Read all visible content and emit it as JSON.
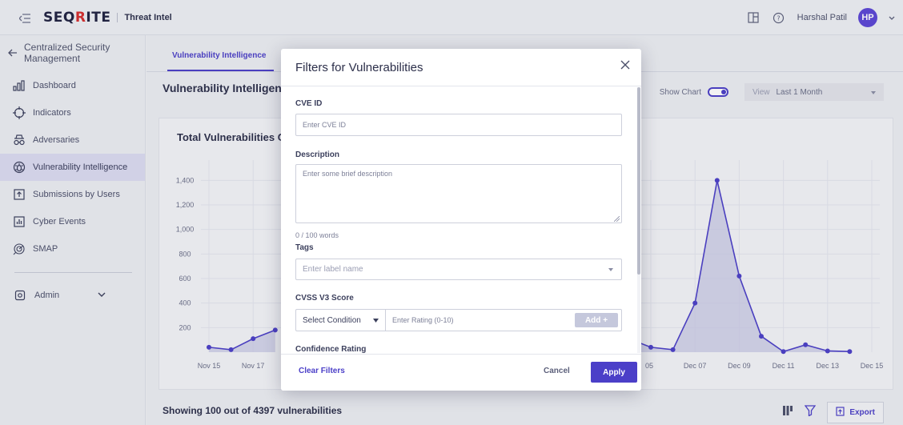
{
  "header": {
    "logo_text_a": "SEQ",
    "logo_text_b": "R",
    "logo_text_c": "ITE",
    "product_name": "Threat Intel",
    "user_name": "Harshal Patil",
    "user_initials": "HP"
  },
  "sidebar": {
    "back_label": "Centralized Security Management",
    "items": [
      {
        "label": "Dashboard",
        "icon": "bar-chart-icon"
      },
      {
        "label": "Indicators",
        "icon": "crosshair-icon"
      },
      {
        "label": "Adversaries",
        "icon": "spy-icon"
      },
      {
        "label": "Vulnerability Intelligence",
        "icon": "bug-icon",
        "active": true
      },
      {
        "label": "Submissions by Users",
        "icon": "upload-icon"
      },
      {
        "label": "Cyber Events",
        "icon": "report-icon"
      },
      {
        "label": "SMAP",
        "icon": "radar-icon"
      }
    ],
    "admin_label": "Admin"
  },
  "main": {
    "tab_label": "Vulnerability Intelligence",
    "page_title": "Vulnerability Intelligence",
    "show_chart_label": "Show Chart",
    "view_label": "View",
    "view_value": "Last 1 Month",
    "chart_title": "Total Vulnerabilities C",
    "showing_text": "Showing 100 out of 4397 vulnerabilities",
    "export_label": "Export"
  },
  "chart_data": {
    "type": "area",
    "title": "Total Vulnerabilities C",
    "y_ticks": [
      "1,400",
      "1,200",
      "1,000",
      "800",
      "600",
      "400",
      "200"
    ],
    "ylim": [
      0,
      1500
    ],
    "x_tick_labels_left": [
      "Nov 15",
      "Nov 17"
    ],
    "x_tick_labels_right": [
      "05",
      "Dec 07",
      "Dec 09",
      "Dec 11",
      "Dec 13",
      "Dec 15"
    ],
    "series_left": [
      {
        "date": "Nov 15",
        "value": 40
      },
      {
        "date": "Nov 16",
        "value": 20
      },
      {
        "date": "Nov 17",
        "value": 110
      },
      {
        "date": "Nov 18",
        "value": 180
      }
    ],
    "series_right": [
      {
        "date": "Dec 04",
        "value": 110
      },
      {
        "date": "Dec 05",
        "value": 40
      },
      {
        "date": "Dec 06",
        "value": 20
      },
      {
        "date": "Dec 07",
        "value": 400
      },
      {
        "date": "Dec 08",
        "value": 1400
      },
      {
        "date": "Dec 09",
        "value": 620
      },
      {
        "date": "Dec 10",
        "value": 130
      },
      {
        "date": "Dec 11",
        "value": 5
      },
      {
        "date": "Dec 12",
        "value": 60
      },
      {
        "date": "Dec 13",
        "value": 10
      },
      {
        "date": "Dec 14",
        "value": 5
      }
    ],
    "line_color": "#4b3fc8",
    "fill_color": "#c8c8e6"
  },
  "modal": {
    "title": "Filters for Vulnerabilities",
    "cve_label": "CVE ID",
    "cve_placeholder": "Enter CVE ID",
    "description_label": "Description",
    "description_placeholder": "Enter some brief description",
    "word_count": "0 / 100 words",
    "tags_label": "Tags",
    "tags_placeholder": "Enter label name",
    "cvss_label": "CVSS V3 Score",
    "cvss_condition": "Select Condition",
    "cvss_rating_placeholder": "Enter Rating (0-10)",
    "add_label": "Add",
    "confidence_label": "Confidence Rating",
    "clear_label": "Clear Filters",
    "cancel_label": "Cancel",
    "apply_label": "Apply"
  },
  "colors": {
    "accent": "#4b3fc8",
    "brand_red": "#d62d2d"
  }
}
